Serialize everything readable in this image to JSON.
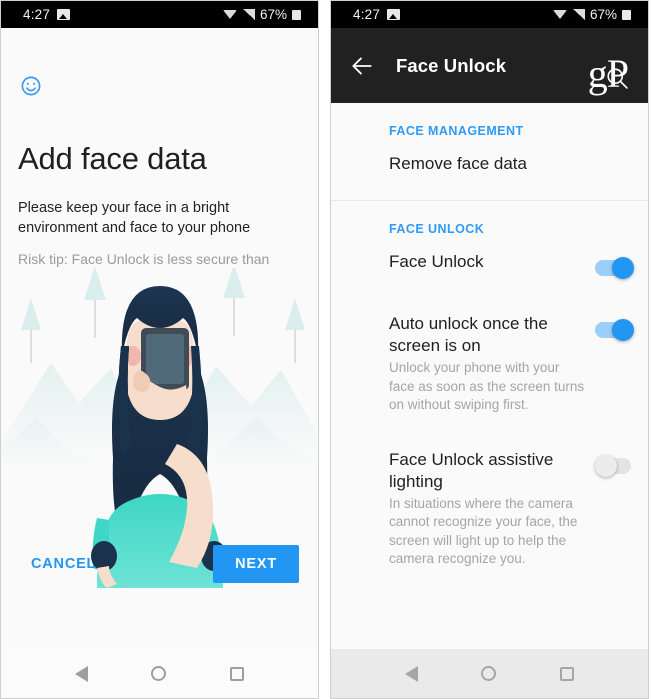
{
  "status_bar": {
    "time": "4:27",
    "battery_percent": "67%",
    "icons": [
      "photo-icon",
      "wifi-icon",
      "signal-icon",
      "battery-icon"
    ]
  },
  "left_screen": {
    "badge_icon": "face-smiley-icon",
    "title": "Add face data",
    "subtitle": "Please keep your face in a bright environment and face to your phone",
    "risk_tip": "Risk tip: Face Unlock is less secure than",
    "illustration": {
      "name": "woman-holding-phone-illustration",
      "description": "Woman with long dark hair holding a smartphone in front of her face, pale mint mountains and trees in the background"
    },
    "cancel_label": "CANCEL",
    "next_label": "NEXT",
    "accent_color": "#2196f3"
  },
  "right_screen": {
    "appbar": {
      "back_icon": "back-arrow-icon",
      "title": "Face Unlock",
      "search_icon": "search-icon",
      "watermark": "gP",
      "background_color": "#212121"
    },
    "sections": [
      {
        "header": "FACE MANAGEMENT",
        "rows": [
          {
            "title": "Remove face data",
            "desc": "",
            "toggle": null
          }
        ]
      },
      {
        "header": "FACE UNLOCK",
        "rows": [
          {
            "title": "Face Unlock",
            "desc": "",
            "toggle": "on"
          },
          {
            "title": "Auto unlock once the screen is on",
            "desc": "Unlock your phone with your face as soon as the screen turns on without swiping first.",
            "toggle": "on"
          },
          {
            "title": "Face Unlock assistive lighting",
            "desc": "In situations where the camera cannot recognize your face, the screen will light up to help the camera recognize you.",
            "toggle": "off"
          }
        ]
      }
    ],
    "section_header_color": "#2f9bf7",
    "toggle_on_color": "#2196f3"
  },
  "nav_bar": {
    "back": "nav-back-icon",
    "home": "nav-home-icon",
    "recents": "nav-recents-icon"
  }
}
